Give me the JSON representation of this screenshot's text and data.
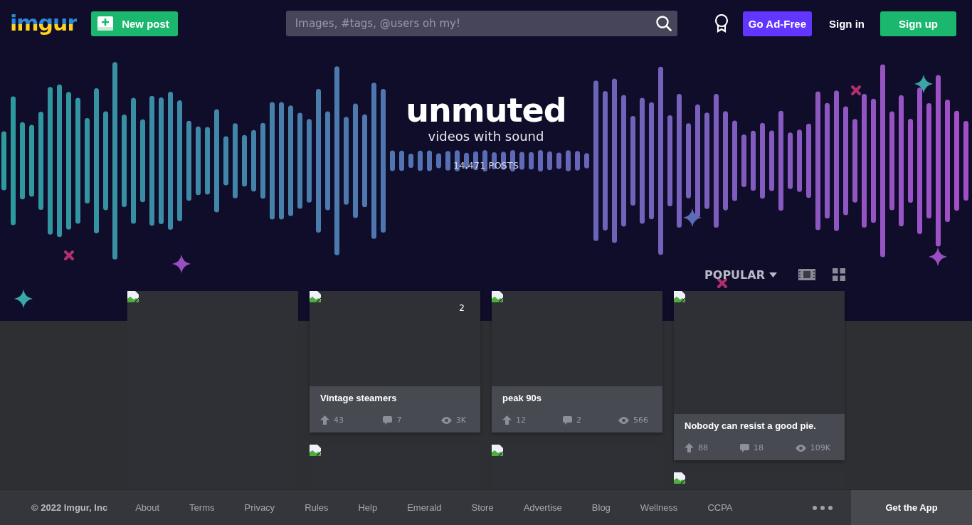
{
  "header": {
    "logo": "imgur",
    "new_post": "New post",
    "search": {
      "placeholder": "Images, #tags, @users oh my!"
    },
    "go_ad_free": "Go Ad-Free",
    "sign_in": "Sign in",
    "sign_up": "Sign up"
  },
  "tag": {
    "title": "unmuted",
    "subtitle": "videos with sound",
    "count": "14,471 POSTS"
  },
  "sort": {
    "label": "POPULAR"
  },
  "columns": [
    {
      "posts": [
        {
          "kind": "image"
        }
      ]
    },
    {
      "posts": [
        {
          "kind": "post",
          "badge": "2",
          "title": "Vintage steamers",
          "upvotes": "43",
          "comments": "7",
          "views": "3K"
        },
        {
          "kind": "image"
        }
      ]
    },
    {
      "posts": [
        {
          "kind": "post",
          "title": "peak 90s",
          "upvotes": "12",
          "comments": "2",
          "views": "566"
        },
        {
          "kind": "image"
        }
      ]
    },
    {
      "posts": [
        {
          "kind": "post",
          "title": "Nobody can resist a good pie.",
          "upvotes": "88",
          "comments": "18",
          "views": "109K"
        },
        {
          "kind": "image"
        }
      ]
    }
  ],
  "footer": {
    "copyright": "© 2022 Imgur, Inc",
    "links": [
      "About",
      "Terms",
      "Privacy",
      "Rules",
      "Help",
      "Emerald",
      "Store",
      "Advertise",
      "Blog",
      "Wellness",
      "CCPA"
    ],
    "get_app": "Get the App"
  }
}
